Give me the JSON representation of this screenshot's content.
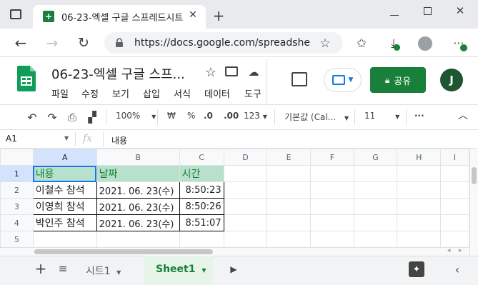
{
  "browser": {
    "tab_title": "06-23-엑셀 구글 스프레드시트 -",
    "url": "https://docs.google.com/spreadsheet..."
  },
  "doc": {
    "title": "06-23-엑셀 구글 스프...",
    "menus": [
      "파일",
      "수정",
      "보기",
      "삽입",
      "서식",
      "데이터",
      "도구"
    ],
    "share_label": "공유",
    "avatar_initial": "J"
  },
  "toolbar": {
    "zoom": "100%",
    "currency": "₩",
    "percent": "%",
    "dec_decrease": ".0",
    "dec_increase": ".00",
    "format_more": "123",
    "font": "기본값 (Cal...",
    "font_size": "11",
    "more": "···"
  },
  "formula_bar": {
    "cell_ref": "A1",
    "fx": "fx",
    "value": "내용"
  },
  "grid": {
    "columns": [
      "A",
      "B",
      "C",
      "D",
      "E",
      "F",
      "G",
      "H",
      "I"
    ],
    "rows": [
      "1",
      "2",
      "3",
      "4",
      "5"
    ],
    "header_row": [
      "내용",
      "날짜",
      "시간"
    ],
    "data": [
      [
        "이철수 참석",
        "2021. 06. 23(수)",
        "8:50:23"
      ],
      [
        "이영희 참석",
        "2021. 06. 23(수)",
        "8:50:26"
      ],
      [
        "박인주 참석",
        "2021. 06. 23(수)",
        "8:51:07"
      ]
    ]
  },
  "sheets": {
    "tabs": [
      "시트1",
      "Sheet1"
    ],
    "active": "Sheet1"
  },
  "colors": {
    "accent_green": "#188038",
    "header_fill": "#b7e1cd",
    "selection_blue": "#1a73e8"
  }
}
